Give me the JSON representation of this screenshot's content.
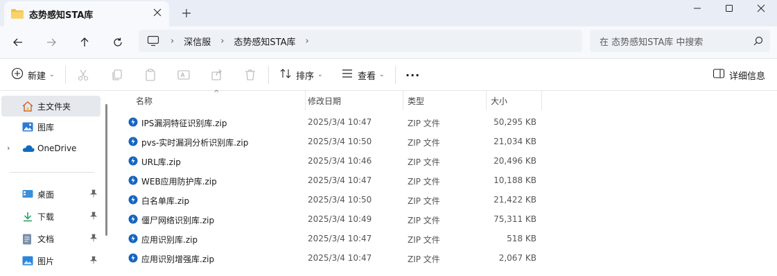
{
  "window": {
    "tab_title": "态势感知STA库",
    "tab_close_icon": "close-icon",
    "new_tab_icon": "plus-icon"
  },
  "nav": {
    "back_icon": "arrow-left-icon",
    "forward_icon": "arrow-right-icon",
    "up_icon": "arrow-up-icon",
    "refresh_icon": "refresh-icon"
  },
  "address": {
    "root_icon": "computer-icon",
    "crumbs": [
      "深信服",
      "态势感知STA库"
    ]
  },
  "search": {
    "placeholder": "在 态势感知STA库 中搜索"
  },
  "toolbar": {
    "new_label": "新建",
    "sort_label": "排序",
    "view_label": "查看",
    "more_label": "···",
    "details_label": "详细信息"
  },
  "sidebar": {
    "items": [
      {
        "label": "主文件夹",
        "icon": "home-icon"
      },
      {
        "label": "图库",
        "icon": "gallery-icon"
      },
      {
        "label": "OneDrive",
        "icon": "cloud-icon"
      },
      {
        "label": "桌面",
        "icon": "desktop-icon"
      },
      {
        "label": "下载",
        "icon": "download-icon"
      },
      {
        "label": "文档",
        "icon": "document-icon"
      },
      {
        "label": "图片",
        "icon": "pictures-icon"
      }
    ]
  },
  "columns": {
    "name": "名称",
    "date": "修改日期",
    "type": "类型",
    "size": "大小"
  },
  "files": [
    {
      "name": "IPS漏洞特征识别库.zip",
      "date": "2025/3/4 10:47",
      "type": "ZIP 文件",
      "size": "50,295 KB"
    },
    {
      "name": "pvs-实时漏洞分析识别库.zip",
      "date": "2025/3/4 10:50",
      "type": "ZIP 文件",
      "size": "21,034 KB"
    },
    {
      "name": "URL库.zip",
      "date": "2025/3/4 10:46",
      "type": "ZIP 文件",
      "size": "20,496 KB"
    },
    {
      "name": "WEB应用防护库.zip",
      "date": "2025/3/4 10:47",
      "type": "ZIP 文件",
      "size": "10,188 KB"
    },
    {
      "name": "白名单库.zip",
      "date": "2025/3/4 10:50",
      "type": "ZIP 文件",
      "size": "21,422 KB"
    },
    {
      "name": "僵尸网络识别库.zip",
      "date": "2025/3/4 10:49",
      "type": "ZIP 文件",
      "size": "75,311 KB"
    },
    {
      "name": "应用识别库.zip",
      "date": "2025/3/4 10:47",
      "type": "ZIP 文件",
      "size": "518 KB"
    },
    {
      "name": "应用识别增强库.zip",
      "date": "2025/3/4 10:47",
      "type": "ZIP 文件",
      "size": "2,067 KB"
    }
  ],
  "colors": {
    "accent": "#0067c0",
    "folder": "#f3c041",
    "selected": "#e5e8ed"
  }
}
